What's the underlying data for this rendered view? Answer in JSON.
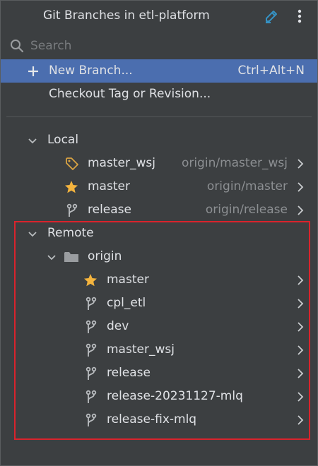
{
  "header": {
    "title": "Git Branches in etl-platform",
    "edit_icon": "edit-pencil-icon",
    "more_icon": "more-vertical-icon"
  },
  "search": {
    "placeholder": "Search",
    "icon": "search-icon"
  },
  "actions": [
    {
      "label": "New Branch...",
      "shortcut": "Ctrl+Alt+N",
      "selected": true
    },
    {
      "label": "Checkout Tag or Revision...",
      "shortcut": "",
      "selected": false
    }
  ],
  "local": {
    "label": "Local",
    "branches": [
      {
        "name": "master_wsj",
        "tracking": "origin/master_wsj",
        "icon": "tag-icon"
      },
      {
        "name": "master",
        "tracking": "origin/master",
        "icon": "star-icon"
      },
      {
        "name": "release",
        "tracking": "origin/release",
        "icon": "branch-icon"
      }
    ]
  },
  "remote": {
    "label": "Remote",
    "origin": {
      "label": "origin",
      "icon": "folder-icon",
      "branches": [
        {
          "name": "master",
          "icon": "star-icon"
        },
        {
          "name": "cpl_etl",
          "icon": "branch-icon"
        },
        {
          "name": "dev",
          "icon": "branch-icon"
        },
        {
          "name": "master_wsj",
          "icon": "branch-icon"
        },
        {
          "name": "release",
          "icon": "branch-icon"
        },
        {
          "name": "release-20231127-mlq",
          "icon": "branch-icon"
        },
        {
          "name": "release-fix-mlq",
          "icon": "branch-icon"
        }
      ]
    }
  },
  "colors": {
    "background": "#3c3f41",
    "selection": "#4b6eaf",
    "text": "#dfe1e5",
    "muted_text": "#8c8f92",
    "star": "#f4b43e",
    "tag": "#d9a343",
    "highlight_box": "#d9232c",
    "edit_icon": "#3592c4"
  }
}
